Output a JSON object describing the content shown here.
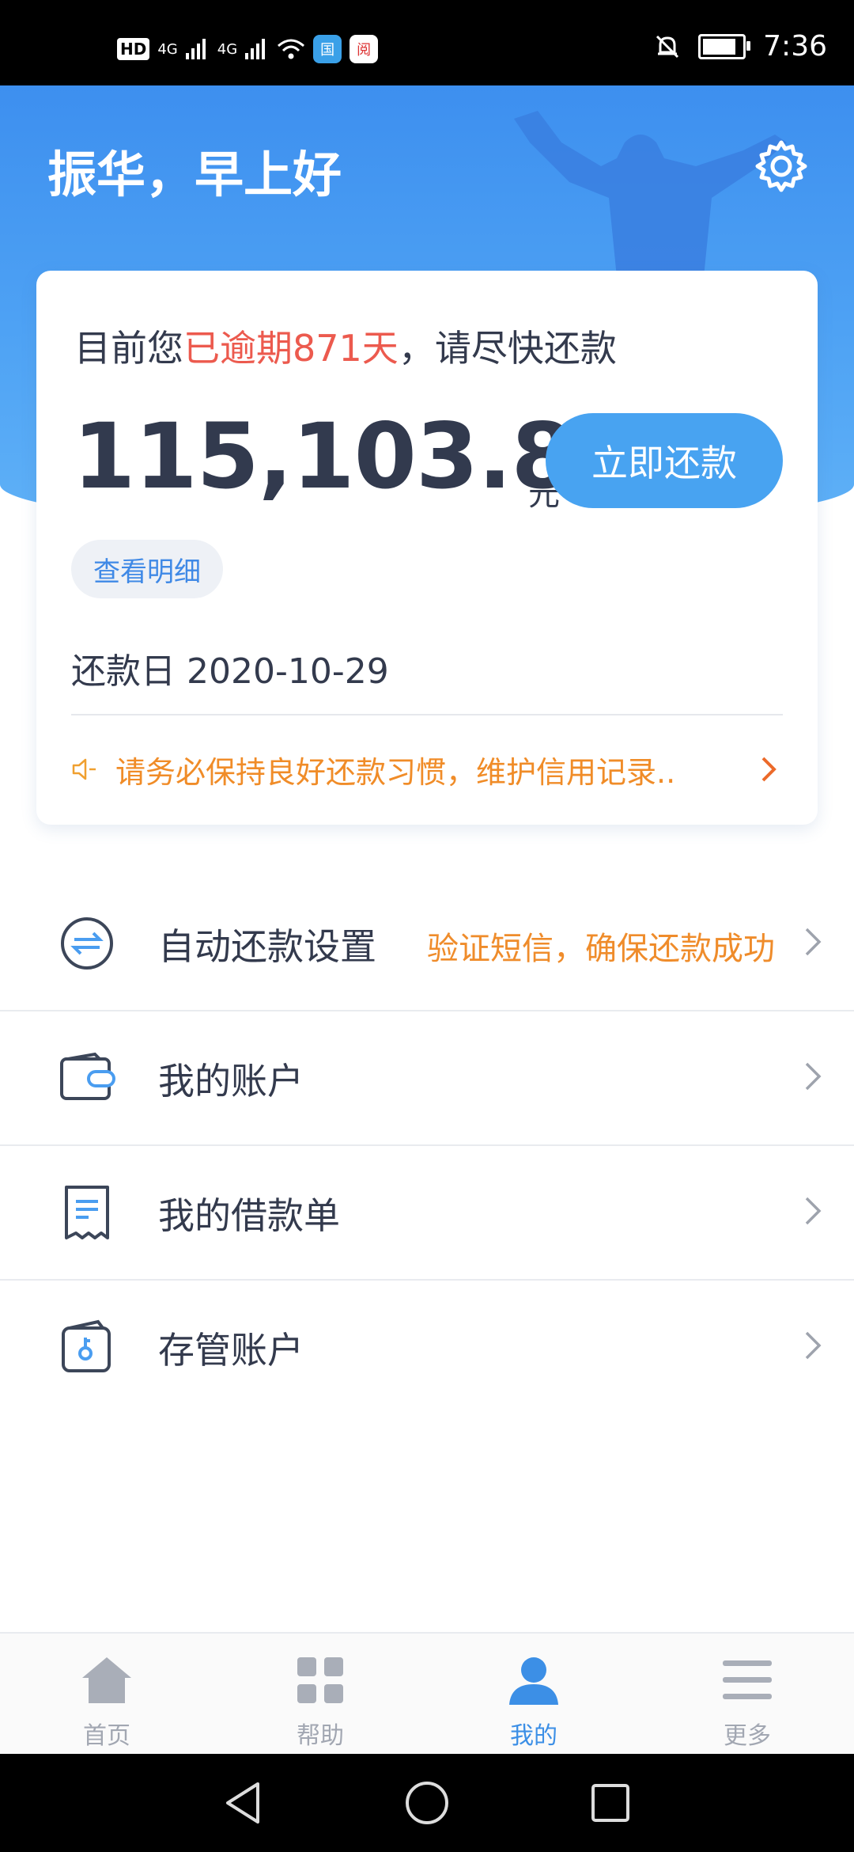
{
  "status_bar": {
    "left": [
      "HD",
      "4G",
      "4G",
      "wifi-icon",
      "app-icon-1",
      "app-icon-2"
    ],
    "hd_label": "HD",
    "net1": "4G",
    "net2": "4G",
    "app1_label": "国",
    "app2_label": "阅",
    "time": "7:36",
    "battery_level": 0.85
  },
  "header": {
    "greeting": "振华，早上好",
    "settings_icon": "gear-icon"
  },
  "repay_card": {
    "notice_prefix": "目前您",
    "notice_overdue": "已逾期871天",
    "notice_suffix": "，请尽快还款",
    "amount": "115,103.83",
    "unit": "元",
    "pay_button": "立即还款",
    "detail_button": "查看明细",
    "due_date": "还款日 2020-10-29",
    "tip": "请务必保持良好还款习惯，维护信用记录..",
    "colors": {
      "warning": "#ec5a4e",
      "accent": "#48a3f1",
      "tip": "#f08c28"
    }
  },
  "menu": [
    {
      "icon": "auto-repay-icon",
      "label": "自动还款设置",
      "hint": "验证短信，确保还款成功"
    },
    {
      "icon": "wallet-icon",
      "label": "我的账户",
      "hint": ""
    },
    {
      "icon": "receipt-icon",
      "label": "我的借款单",
      "hint": ""
    },
    {
      "icon": "custody-account-icon",
      "label": "存管账户",
      "hint": ""
    }
  ],
  "tabbar": [
    {
      "icon": "home-icon",
      "label": "首页",
      "active": false
    },
    {
      "icon": "grid-icon",
      "label": "帮助",
      "active": false
    },
    {
      "icon": "user-icon",
      "label": "我的",
      "active": true
    },
    {
      "icon": "menu-icon",
      "label": "更多",
      "active": false
    }
  ],
  "navbar": [
    "back-icon",
    "home-circle-icon",
    "recents-icon"
  ]
}
